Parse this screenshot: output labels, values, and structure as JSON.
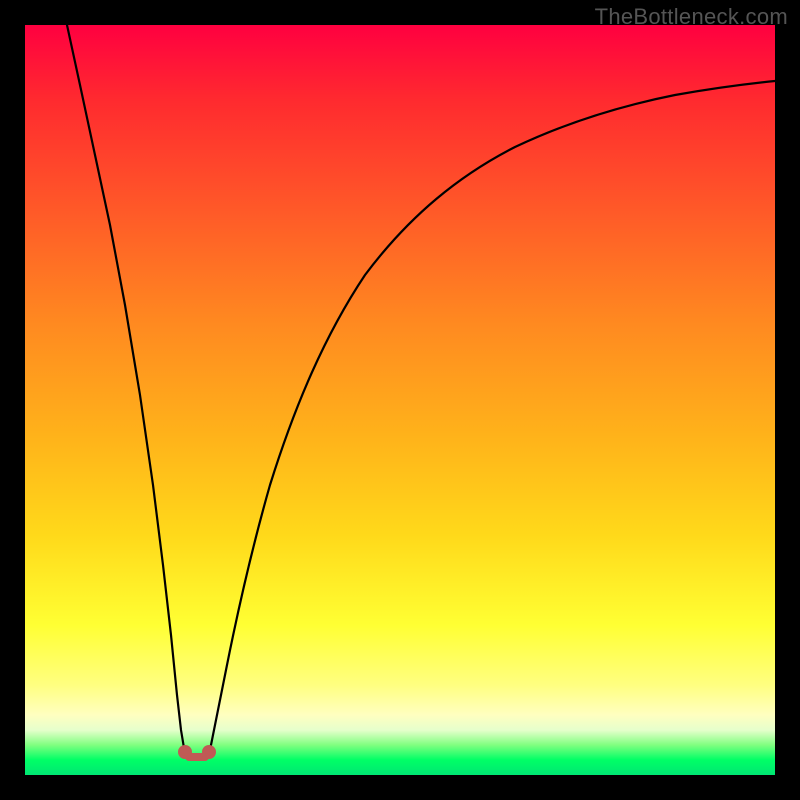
{
  "watermark": "TheBottleneck.com",
  "colors": {
    "frame": "#000000",
    "curve": "#000000",
    "marker": "#c05a55"
  },
  "chart_data": {
    "type": "line",
    "title": "",
    "xlabel": "",
    "ylabel": "",
    "xlim": [
      0,
      100
    ],
    "ylim": [
      0,
      100
    ],
    "grid": false,
    "legend": false,
    "x": [
      0,
      2,
      4,
      6,
      8,
      10,
      12,
      14,
      16,
      18,
      19,
      20,
      21,
      22,
      23,
      24,
      25,
      27,
      30,
      35,
      40,
      45,
      50,
      55,
      60,
      65,
      70,
      75,
      80,
      85,
      90,
      95,
      100
    ],
    "values": [
      100,
      90,
      80,
      70,
      60,
      50,
      40,
      30,
      20,
      8,
      3,
      0,
      0,
      0,
      3,
      8,
      15,
      25,
      38,
      52,
      62,
      69,
      74,
      78,
      81,
      83.5,
      85.5,
      87,
      88.3,
      89.3,
      90,
      90.5,
      91
    ],
    "markers": [
      {
        "x": 19.5,
        "y": 2
      },
      {
        "x": 22.5,
        "y": 2
      }
    ],
    "annotations": [],
    "notes": "V-shaped bottleneck curve: minimum (optimal match) near x≈20–22; y rises steeply away from the minimum and asymptotes toward ~90 on the right."
  }
}
